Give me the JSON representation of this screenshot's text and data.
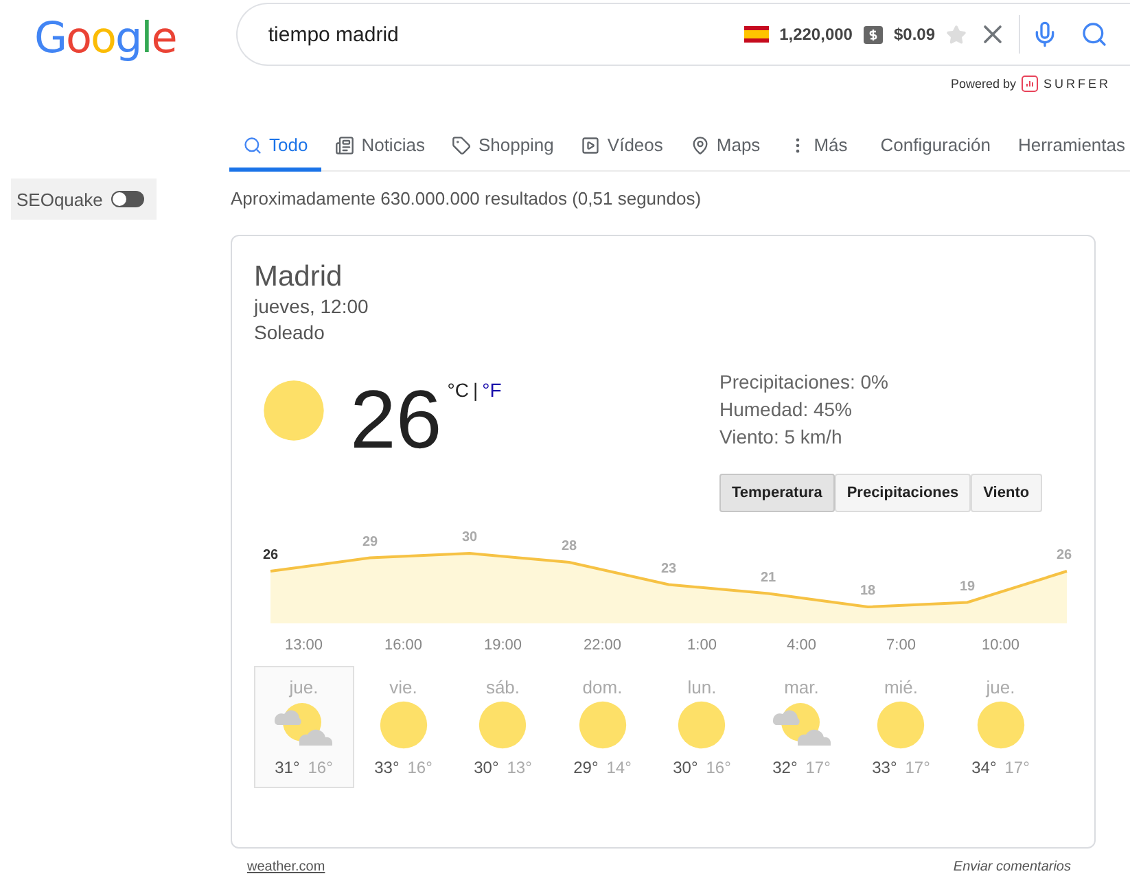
{
  "logo": "Google",
  "search": {
    "value": "tiempo madrid",
    "volume": "1,220,000",
    "cpc": "$0.09",
    "starred": false,
    "powered_by": "Powered by",
    "brand": "SURFER"
  },
  "tabs": [
    {
      "label": "Todo",
      "selected": true
    },
    {
      "label": "Noticias",
      "selected": false
    },
    {
      "label": "Shopping",
      "selected": false
    },
    {
      "label": "Vídeos",
      "selected": false
    },
    {
      "label": "Maps",
      "selected": false
    },
    {
      "label": "Más",
      "selected": false
    },
    {
      "label": "Configuración",
      "selected": false
    },
    {
      "label": "Herramientas",
      "selected": false
    }
  ],
  "seoquake": {
    "label": "SEOquake",
    "on": false
  },
  "results_count": "Aproximadamente 630.000.000 resultados (0,51 segundos)",
  "weather": {
    "city": "Madrid",
    "time": "jueves, 12:00",
    "condition": "Soleado",
    "temperature": "26",
    "units": [
      {
        "label": "°C",
        "selected": true
      },
      {
        "label": "°F",
        "selected": false
      }
    ],
    "unit_separator": "|",
    "details": [
      "Precipitaciones: 0%",
      "Humedad: 45%",
      "Viento: 5 km/h"
    ],
    "modes": [
      {
        "label": "Temperatura",
        "selected": true
      },
      {
        "label": "Precipitaciones",
        "selected": false
      },
      {
        "label": "Viento",
        "selected": false
      }
    ],
    "chart_data": {
      "type": "area",
      "categories": [
        null,
        null,
        null,
        null,
        null,
        null,
        null,
        null,
        null
      ],
      "series": [
        {
          "color": "#f6c244",
          "values": [
            26,
            29,
            30,
            28,
            23,
            21,
            18,
            19,
            26
          ]
        }
      ],
      "data_labels": true
    },
    "hours": [
      "13:00",
      "16:00",
      "19:00",
      "22:00",
      "1:00",
      "4:00",
      "7:00",
      "10:00"
    ],
    "days": [
      {
        "day": "jue.",
        "kind": "partly-cloudy",
        "high": "31°",
        "low": "16°",
        "selected": true
      },
      {
        "day": "vie.",
        "kind": "sunny",
        "high": "33°",
        "low": "16°",
        "selected": false
      },
      {
        "day": "sáb.",
        "kind": "sunny",
        "high": "30°",
        "low": "13°",
        "selected": false
      },
      {
        "day": "dom.",
        "kind": "sunny",
        "high": "29°",
        "low": "14°",
        "selected": false
      },
      {
        "day": "lun.",
        "kind": "sunny",
        "high": "30°",
        "low": "16°",
        "selected": false
      },
      {
        "day": "mar.",
        "kind": "partly-cloudy",
        "high": "32°",
        "low": "17°",
        "selected": false
      },
      {
        "day": "mié.",
        "kind": "sunny",
        "high": "33°",
        "low": "17°",
        "selected": false
      },
      {
        "day": "jue.",
        "kind": "sunny",
        "high": "34°",
        "low": "17°",
        "selected": false
      }
    ],
    "source": "weather.com",
    "feedback": "Enviar comentarios"
  }
}
